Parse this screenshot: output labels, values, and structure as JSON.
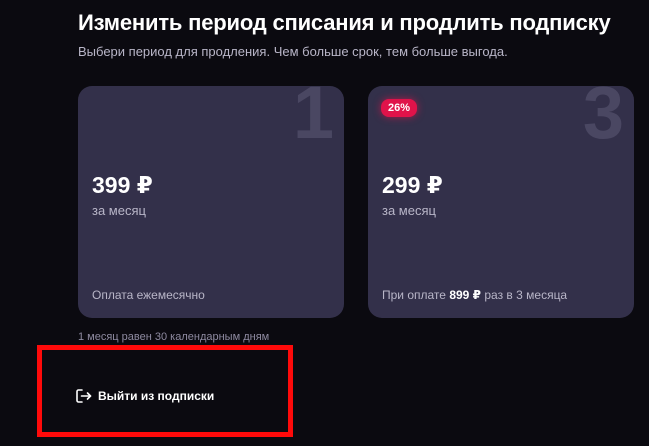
{
  "header": {
    "title": "Изменить период списания и продлить подписку",
    "subtitle": "Выбери период для продления. Чем больше срок, тем больше выгода."
  },
  "plans": [
    {
      "number": "1",
      "price": "399 ₽",
      "period": "за месяц",
      "footer": "Оплата ежемесячно"
    },
    {
      "number": "3",
      "badge": "26%",
      "price": "299 ₽",
      "period": "за месяц",
      "footer_prefix": "При оплате",
      "footer_amount": "899 ₽",
      "footer_suffix": "раз в 3 месяца"
    }
  ],
  "note": "1 месяц равен 30 календарным дням",
  "exit": {
    "label": "Выйти из подписки",
    "icon": "logout-icon"
  },
  "colors": {
    "background": "#0b0a10",
    "card": "#33304a",
    "badge": "#e0134a",
    "highlight": "#ff0a0a"
  }
}
